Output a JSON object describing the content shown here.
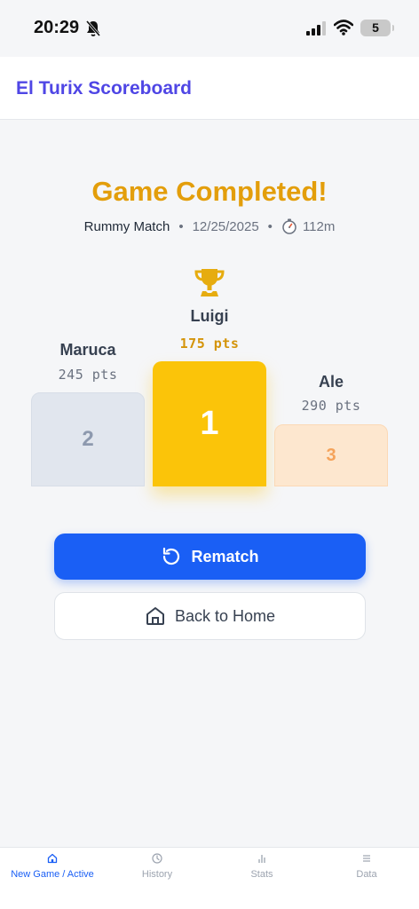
{
  "status_bar": {
    "time": "20:29",
    "battery": "5"
  },
  "header": {
    "title": "El Turix Scoreboard"
  },
  "game": {
    "heading": "Game Completed!",
    "type": "Rummy Match",
    "date": "12/25/2025",
    "duration": "112m",
    "separator": "•"
  },
  "podium": [
    {
      "rank": "1",
      "name": "Luigi",
      "points": "175 pts"
    },
    {
      "rank": "2",
      "name": "Maruca",
      "points": "245 pts"
    },
    {
      "rank": "3",
      "name": "Ale",
      "points": "290 pts"
    }
  ],
  "actions": {
    "rematch": "Rematch",
    "home": "Back to Home"
  },
  "nav": [
    {
      "label": "New Game / Active",
      "icon": "home-icon",
      "active": true
    },
    {
      "label": "History",
      "icon": "clock-icon",
      "active": false
    },
    {
      "label": "Stats",
      "icon": "bar-chart-icon",
      "active": false
    },
    {
      "label": "Data",
      "icon": "menu-icon",
      "active": false
    }
  ],
  "colors": {
    "brand": "#4f46e5",
    "accent": "#1a5ff5",
    "gold": "#fbc409",
    "heading": "#e39e0b"
  }
}
